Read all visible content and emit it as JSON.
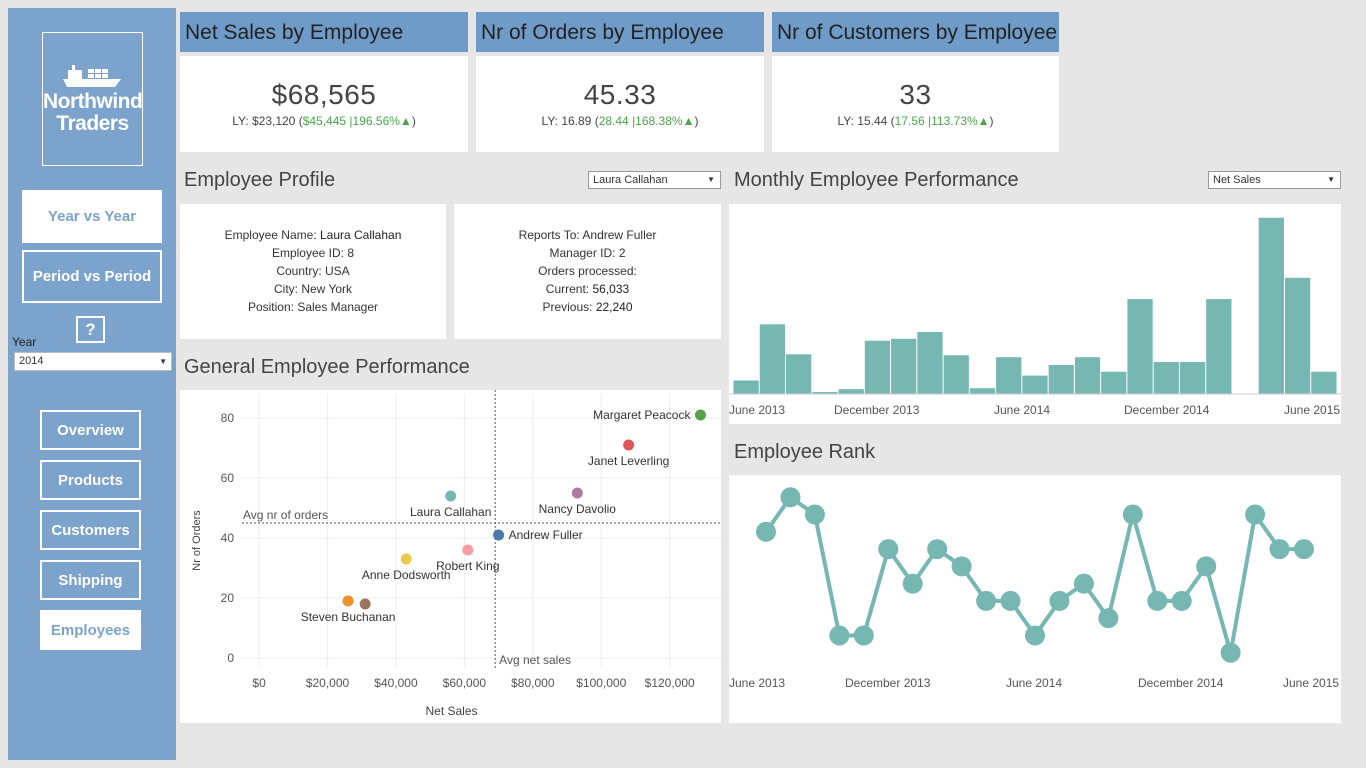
{
  "sidebar": {
    "logo_line1": "Northwind",
    "logo_line2": "Traders",
    "mode_buttons": [
      "Year vs Year",
      "Period vs Period"
    ],
    "help_label": "?",
    "year_label": "Year",
    "year_value": "2014",
    "nav": [
      "Overview",
      "Products",
      "Customers",
      "Shipping",
      "Employees"
    ]
  },
  "kpis": [
    {
      "title": "Net Sales by Employee",
      "value": "$68,565",
      "ly": "LY: $23,120 (",
      "delta": "$45,445",
      "pct": "|196.56%",
      "arrow": "▲",
      "close": ")"
    },
    {
      "title": "Nr of Orders by Employee",
      "value": "45.33",
      "ly": "LY: 16.89 (",
      "delta": "28.44",
      "pct": "|168.38%",
      "arrow": "▲",
      "close": ")"
    },
    {
      "title": "Nr of Customers by Employee",
      "value": "33",
      "ly": "LY: 15.44 (",
      "delta": "17.56",
      "pct": "|113.73%",
      "arrow": "▲",
      "close": ")"
    }
  ],
  "profile": {
    "title": "Employee Profile",
    "employee_select": "Laura Callahan",
    "left": {
      "name_label": "Employee Name: ",
      "name": "Laura Callahan",
      "id": "Employee ID: 8",
      "country": "Country: USA",
      "city": "City: New York",
      "position": "Position: Sales Manager"
    },
    "right": {
      "reports_to": "Reports To: Andrew Fuller",
      "manager_id": "Manager ID: 2",
      "orders_processed": "Orders processed:",
      "current_label": "Current: ",
      "current": "56,033",
      "previous_label": "Previous: ",
      "previous": "22,240"
    }
  },
  "monthly": {
    "title": "Monthly Employee Performance",
    "metric_select": "Net Sales"
  },
  "general": {
    "title": "General Employee Performance"
  },
  "rank": {
    "title": "Employee Rank"
  },
  "colors": {
    "sidebar": "#7ba3cb",
    "kpi_header": "#6f9bc8",
    "teal": "#76b7b2",
    "positive": "#4aa54a"
  },
  "chart_data": [
    {
      "type": "bar",
      "title": "Monthly Employee Performance",
      "x_tick_labels": [
        "June 2013",
        "December 2013",
        "June 2014",
        "December 2014",
        "June 2015"
      ],
      "values": [
        14,
        72,
        41,
        2,
        5,
        55,
        57,
        64,
        40,
        6,
        38,
        19,
        30,
        38,
        23,
        98,
        33,
        33,
        98,
        0,
        182,
        120,
        23
      ],
      "ylim": [
        0,
        190
      ],
      "grid": false
    },
    {
      "type": "scatter",
      "title": "General Employee Performance",
      "xlabel": "Net Sales",
      "ylabel": "Nr of Orders",
      "xlim": [
        -5000,
        135000
      ],
      "ylim": [
        -3,
        88
      ],
      "x_ticks": [
        "$0",
        "$20,000",
        "$40,000",
        "$60,000",
        "$80,000",
        "$100,000",
        "$120,000"
      ],
      "x_tick_values": [
        0,
        20000,
        40000,
        60000,
        80000,
        100000,
        120000
      ],
      "y_ticks": [
        "0",
        "20",
        "40",
        "60",
        "80"
      ],
      "y_tick_values": [
        0,
        20,
        40,
        60,
        80
      ],
      "ref_lines": {
        "avg_orders": {
          "value": 45,
          "label": "Avg nr of orders"
        },
        "avg_sales": {
          "value": 69000,
          "label": "Avg net sales"
        }
      },
      "points": [
        {
          "name": "Margaret Peacock",
          "x": 129000,
          "y": 81,
          "color": "#59a14f",
          "label_pos": "left"
        },
        {
          "name": "Janet Leverling",
          "x": 108000,
          "y": 71,
          "color": "#e15759",
          "label_pos": "below"
        },
        {
          "name": "Laura Callahan",
          "x": 56000,
          "y": 54,
          "color": "#76b7b2",
          "label_pos": "below"
        },
        {
          "name": "Nancy Davolio",
          "x": 93000,
          "y": 55,
          "color": "#b07aa1",
          "label_pos": "below"
        },
        {
          "name": "Andrew Fuller",
          "x": 70000,
          "y": 41,
          "color": "#4e79a7",
          "label_pos": "right"
        },
        {
          "name": "Robert King",
          "x": 61000,
          "y": 36,
          "color": "#ff9da7",
          "label_pos": "below"
        },
        {
          "name": "Anne Dodsworth",
          "x": 43000,
          "y": 33,
          "color": "#edc948",
          "label_pos": "below"
        },
        {
          "name": "Steven Buchanan",
          "x": 26000,
          "y": 19,
          "color": "#f28e2b",
          "label_pos": "below"
        },
        {
          "name": "",
          "x": 31000,
          "y": 18,
          "color": "#9c755f",
          "label_pos": "none"
        }
      ]
    },
    {
      "type": "line",
      "title": "Employee Rank",
      "x_tick_labels": [
        "June 2013",
        "December 2013",
        "June 2014",
        "December 2014",
        "June 2015"
      ],
      "values": [
        3,
        1,
        2,
        9,
        9,
        4,
        6,
        4,
        5,
        7,
        7,
        9,
        7,
        6,
        8,
        2,
        7,
        7,
        5,
        10,
        2,
        4,
        4
      ],
      "ylim": [
        11,
        0
      ],
      "grid": false
    }
  ]
}
